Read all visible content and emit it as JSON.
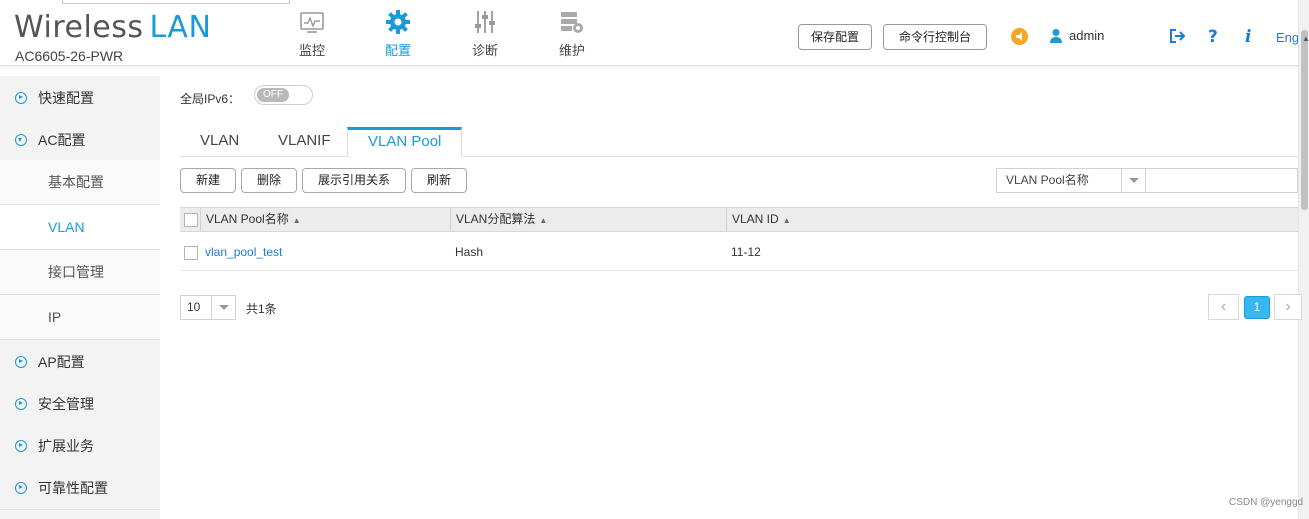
{
  "header": {
    "brand_main": "Wireless",
    "brand_accent": "LAN",
    "model": "AC6605-26-PWR",
    "nav": [
      {
        "label": "监控",
        "icon": "monitor-icon"
      },
      {
        "label": "配置",
        "icon": "gear-icon",
        "active": true
      },
      {
        "label": "诊断",
        "icon": "sliders-icon"
      },
      {
        "label": "维护",
        "icon": "server-gear-icon"
      }
    ],
    "save_config": "保存配置",
    "cli_console": "命令行控制台",
    "user": "admin",
    "language": "Engl",
    "accent_color": "#1a9bd7"
  },
  "sidebar": {
    "items": [
      {
        "label": "快速配置"
      },
      {
        "label": "AC配置"
      },
      {
        "label": "基本配置"
      },
      {
        "label": "VLAN"
      },
      {
        "label": "接口管理"
      },
      {
        "label": "IP"
      },
      {
        "label": "AP配置"
      },
      {
        "label": "安全管理"
      },
      {
        "label": "扩展业务"
      },
      {
        "label": "可靠性配置"
      }
    ]
  },
  "main": {
    "ipv6_label": "全局IPv6：",
    "ipv6_toggle": "OFF",
    "tabs": [
      {
        "label": "VLAN"
      },
      {
        "label": "VLANIF"
      },
      {
        "label": "VLAN Pool",
        "active": true
      }
    ],
    "toolbar": {
      "new": "新建",
      "delete": "删除",
      "show_refs": "展示引用关系",
      "refresh": "刷新"
    },
    "filter": {
      "field": "VLAN Pool名称",
      "value": ""
    },
    "table": {
      "columns": [
        "VLAN Pool名称",
        "VLAN分配算法",
        "VLAN ID"
      ],
      "rows": [
        [
          "vlan_pool_test",
          "Hash",
          "11-12"
        ]
      ]
    },
    "pagination": {
      "page_size": "10",
      "total": "共1条",
      "current_page": "1"
    }
  },
  "watermark": "CSDN @yenggd"
}
